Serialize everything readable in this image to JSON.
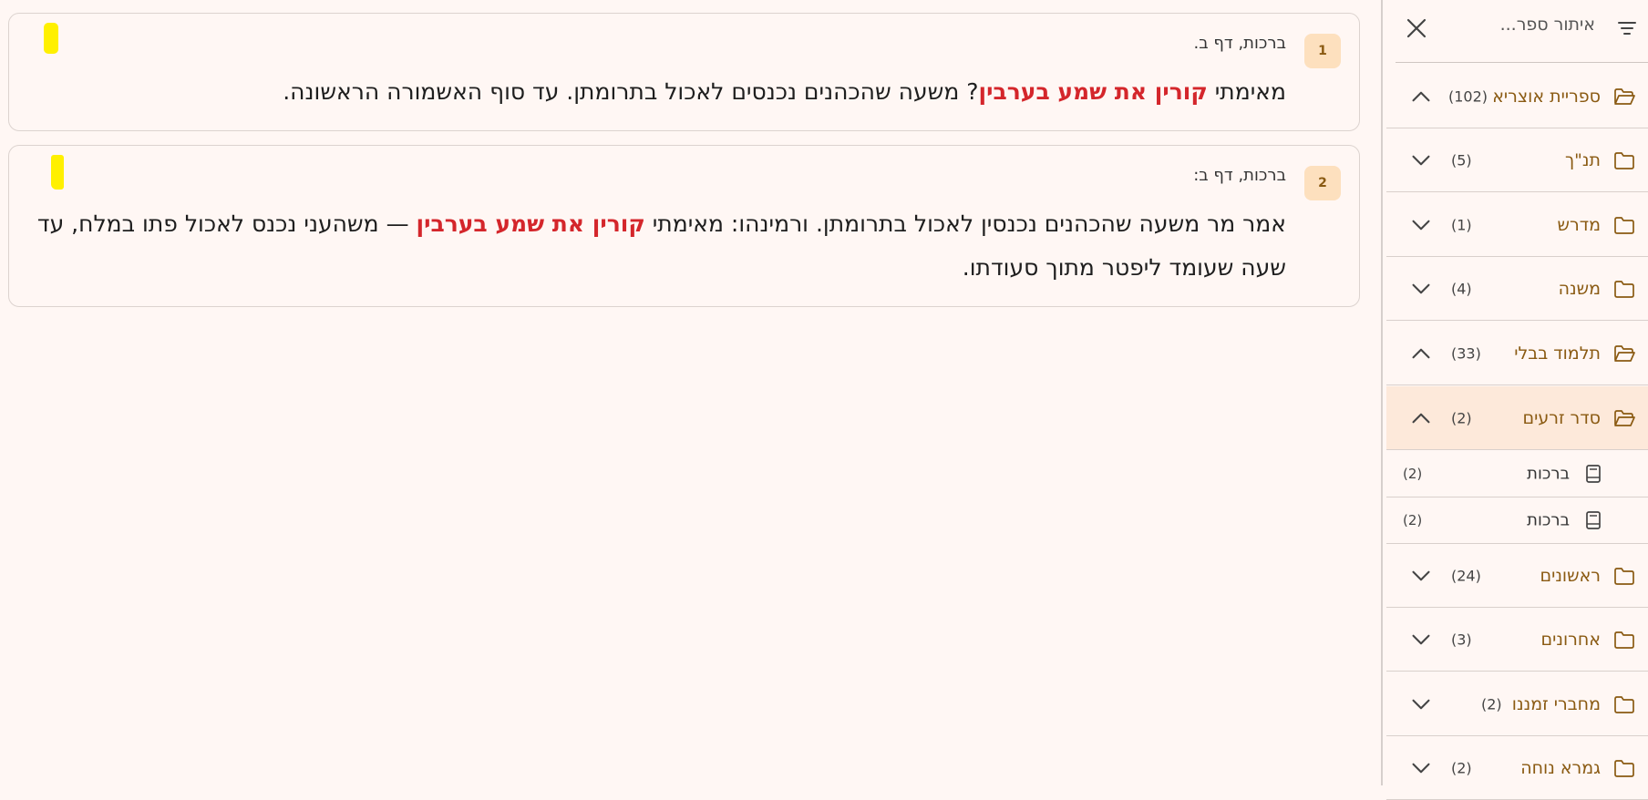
{
  "results": [
    {
      "index": "1",
      "reference": "ברכות, דף ב.",
      "text_before": "מאימתי ",
      "highlight": "קורין את שמע בערבין",
      "text_after": "? משעה שהכהנים נכנסים לאכול בתרומתן. עד סוף האשמורה הראשונה."
    },
    {
      "index": "2",
      "reference": "ברכות, דף ב:",
      "text_before": "אמר מר משעה שהכהנים נכנסין לאכול בתרומתן. ורמינהו: מאימתי ",
      "highlight": "קורין את שמע בערבין",
      "text_after": " — משהעני נכנס לאכול פתו במלח, עד שעה שעומד ליפטר מתוך סעודתו."
    }
  ],
  "sidebar": {
    "filter_placeholder": "איתור ספר...",
    "items": [
      {
        "label": "ספריית אוצריא",
        "count": "(102)",
        "expanded": true,
        "icon": "folder-open-icon"
      },
      {
        "label": "תנ\"ך",
        "count": "(5)",
        "expanded": false,
        "icon": "folder-icon"
      },
      {
        "label": "מדרש",
        "count": "(1)",
        "expanded": false,
        "icon": "folder-icon"
      },
      {
        "label": "משנה",
        "count": "(4)",
        "expanded": false,
        "icon": "folder-icon"
      },
      {
        "label": "תלמוד בבלי",
        "count": "(33)",
        "expanded": true,
        "icon": "folder-open-icon"
      },
      {
        "label": "סדר זרעים",
        "count": "(2)",
        "expanded": true,
        "icon": "folder-open-icon",
        "selected": true
      },
      {
        "label": "ראשונים",
        "count": "(24)",
        "expanded": false,
        "icon": "folder-icon"
      },
      {
        "label": "אחרונים",
        "count": "(3)",
        "expanded": false,
        "icon": "folder-icon"
      },
      {
        "label": "מחברי זמננו",
        "count": "(2)",
        "expanded": false,
        "icon": "folder-icon"
      },
      {
        "label": "גמרא נוחה",
        "count": "(2)",
        "expanded": false,
        "icon": "folder-icon"
      }
    ],
    "books": [
      {
        "label": "ברכות",
        "count": "(2)"
      },
      {
        "label": "ברכות",
        "count": "(2)"
      }
    ]
  },
  "colors": {
    "highlight": "#d4262b",
    "folder": "#8a5a12",
    "badge": "#fde0be",
    "selected": "#fde9da",
    "marker": "#fff000"
  }
}
